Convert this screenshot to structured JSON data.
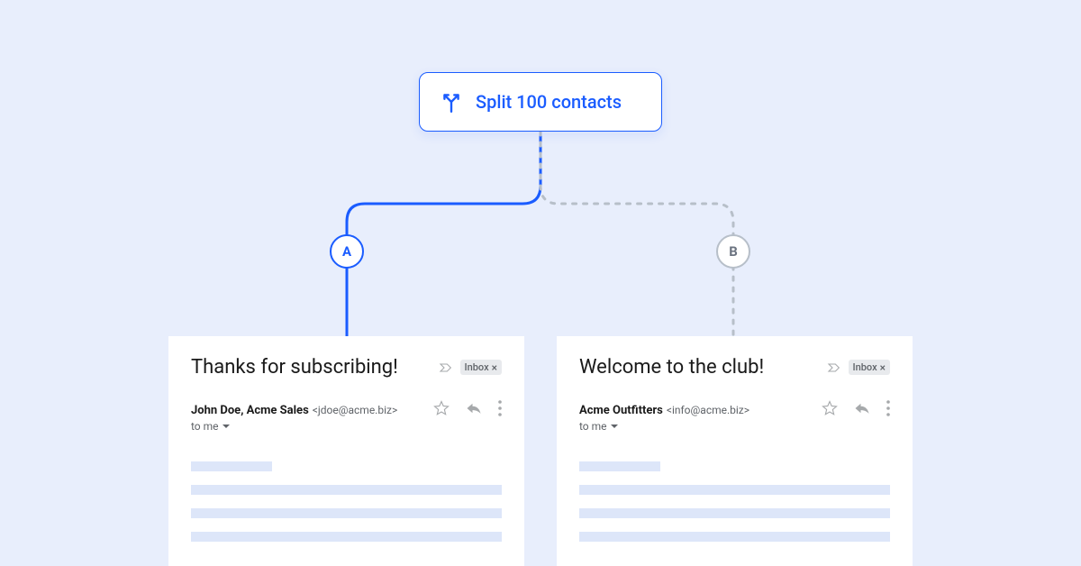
{
  "split": {
    "label": "Split 100 contacts"
  },
  "variants": {
    "a": "A",
    "b": "B"
  },
  "email_a": {
    "subject": "Thanks for subscribing!",
    "inbox_tag": "Inbox",
    "sender_name": "John Doe, Acme Sales",
    "sender_email": "<jdoe@acme.biz>",
    "to_me": "to me"
  },
  "email_b": {
    "subject": "Welcome to the club!",
    "inbox_tag": "Inbox",
    "sender_name": "Acme Outfitters",
    "sender_email": "<info@acme.biz>",
    "to_me": "to me"
  }
}
